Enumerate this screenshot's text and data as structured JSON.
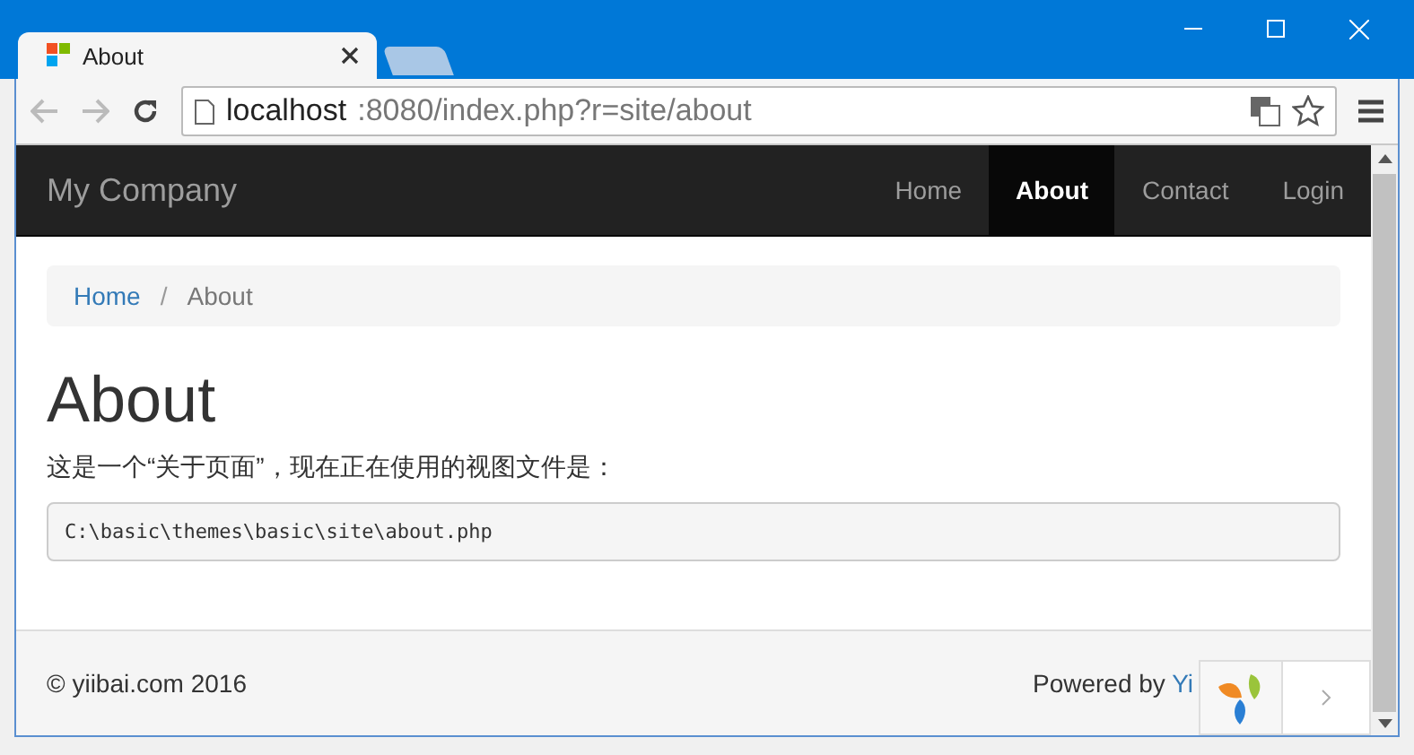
{
  "browser": {
    "tabs": [
      {
        "title": "About",
        "selected": true
      },
      {
        "selected": false
      }
    ],
    "url_host": "localhost",
    "url_rest": ":8080/index.php?r=site/about"
  },
  "navbar": {
    "brand": "My Company",
    "items": [
      {
        "label": "Home",
        "selected": false
      },
      {
        "label": "About",
        "selected": true
      },
      {
        "label": "Contact",
        "selected": false
      },
      {
        "label": "Login",
        "selected": false
      }
    ]
  },
  "breadcrumb_separator": "/",
  "breadcrumb": [
    {
      "label": "Home",
      "selected": false
    },
    {
      "label": "About",
      "selected": true
    }
  ],
  "heading": "About",
  "paragraph": "这是一个“关于页面”，现在正在使用的视图文件是：",
  "code": "C:\\basic\\themes\\basic\\site\\about.php",
  "footer": {
    "copyright": "© yiibai.com 2016",
    "powered_by": "Powered by ",
    "link": "Yi"
  }
}
